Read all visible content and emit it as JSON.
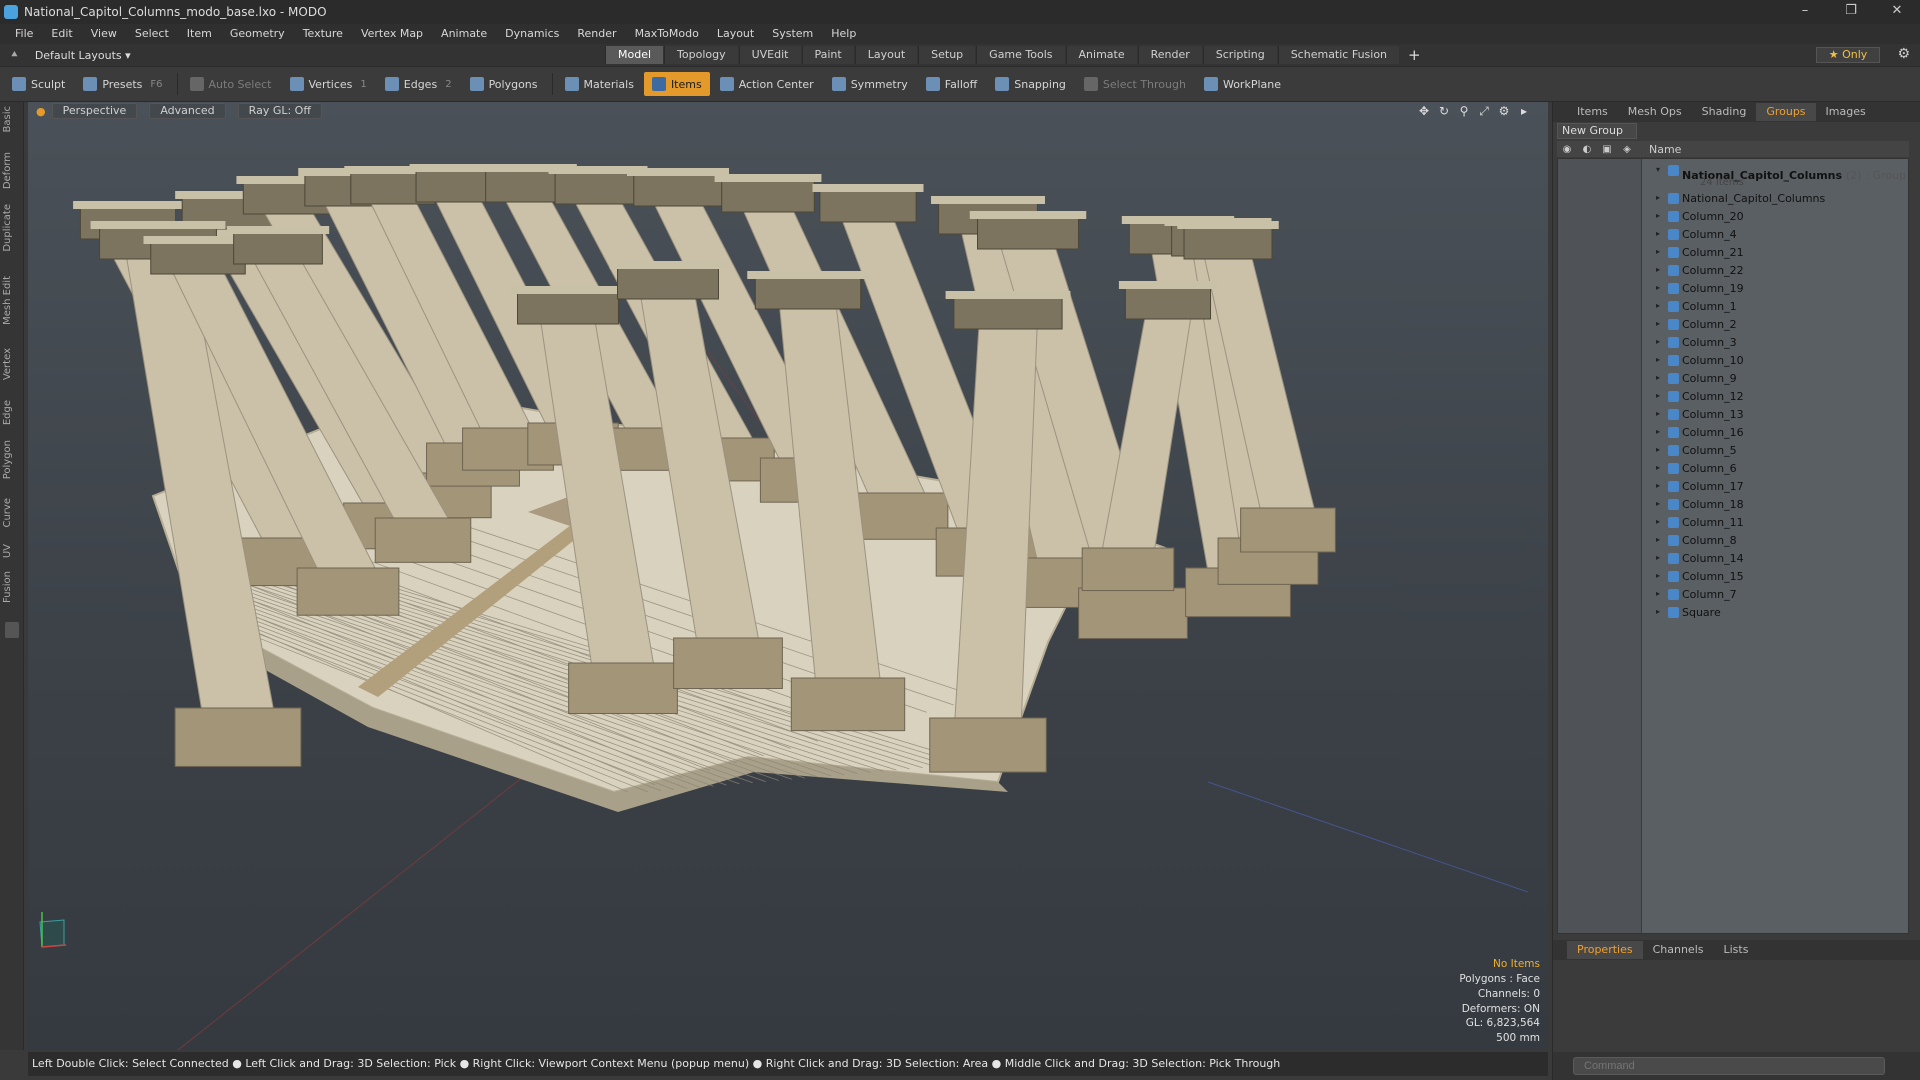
{
  "window": {
    "title": "National_Capitol_Columns_modo_base.lxo - MODO",
    "min": "–",
    "max": "❐",
    "close": "✕"
  },
  "menu": [
    "File",
    "Edit",
    "View",
    "Select",
    "Item",
    "Geometry",
    "Texture",
    "Vertex Map",
    "Animate",
    "Dynamics",
    "Render",
    "MaxToModo",
    "Layout",
    "System",
    "Help"
  ],
  "layout": {
    "label": "Default Layouts",
    "tabs": [
      "Model",
      "Topology",
      "UVEdit",
      "Paint",
      "Layout",
      "Setup",
      "Game Tools",
      "Animate",
      "Render",
      "Scripting",
      "Schematic Fusion"
    ],
    "active": "Model",
    "only_label": "Only"
  },
  "toolbar": {
    "sculpt": "Sculpt",
    "presets": "Presets",
    "presets_key": "F6",
    "auto_select": "Auto Select",
    "vertices": "Vertices",
    "vertices_count": "1",
    "edges": "Edges",
    "edges_count": "2",
    "polygons": "Polygons",
    "materials": "Materials",
    "items": "Items",
    "action_center": "Action Center",
    "symmetry": "Symmetry",
    "falloff": "Falloff",
    "snapping": "Snapping",
    "select_through": "Select Through",
    "workplane": "WorkPlane"
  },
  "left_tabs": [
    "Basic",
    "Deform",
    "Duplicate",
    "Mesh Edit",
    "Vertex",
    "Edge",
    "Polygon",
    "Curve",
    "UV",
    "Fusion"
  ],
  "viewport": {
    "view": "Perspective",
    "mode": "Advanced",
    "raygl": "Ray GL: Off"
  },
  "stats": {
    "items": "No Items",
    "polygons": "Polygons : Face",
    "channels": "Channels: 0",
    "deformers": "Deformers: ON",
    "gl": "GL: 6,823,564",
    "scale": "500 mm"
  },
  "status": "Left Double Click: Select Connected ● Left Click and Drag: 3D Selection: Pick ● Right Click: Viewport Context Menu (popup menu) ● Right Click and Drag: 3D Selection: Area ● Middle Click and Drag: 3D Selection: Pick Through",
  "panel": {
    "tabs": [
      "Items",
      "Mesh Ops",
      "Shading",
      "Groups",
      "Images"
    ],
    "active": "Groups",
    "new_group": "New Group",
    "name_header": "Name",
    "group": {
      "name": "National_Capitol_Columns",
      "count": "(2)",
      "type": ": Group",
      "items": "24 Items"
    },
    "children": [
      "National_Capitol_Columns",
      "Column_20",
      "Column_4",
      "Column_21",
      "Column_22",
      "Column_19",
      "Column_1",
      "Column_2",
      "Column_3",
      "Column_10",
      "Column_9",
      "Column_12",
      "Column_13",
      "Column_16",
      "Column_5",
      "Column_6",
      "Column_17",
      "Column_18",
      "Column_11",
      "Column_8",
      "Column_14",
      "Column_15",
      "Column_7",
      "Square"
    ],
    "bottom_tabs": [
      "Properties",
      "Channels",
      "Lists"
    ],
    "bottom_active": "Properties",
    "command_placeholder": "Command"
  },
  "colors": {
    "accent": "#e39a2a",
    "selection": "#f0a030"
  }
}
